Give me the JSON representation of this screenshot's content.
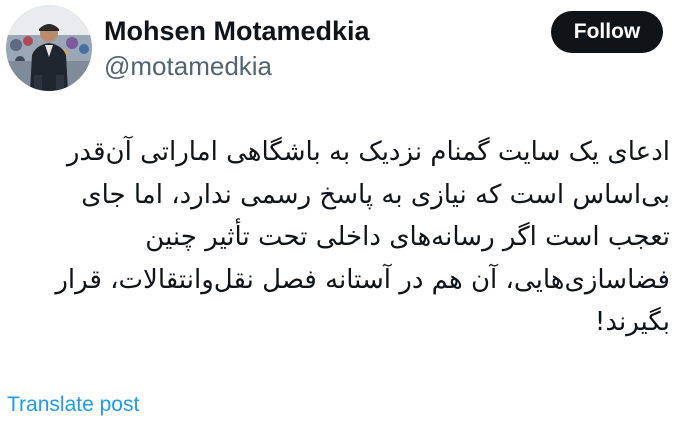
{
  "author": {
    "display_name": "Mohsen Motamedkia",
    "handle": "@motamedkia"
  },
  "actions": {
    "follow_label": "Follow",
    "translate_label": "Translate post"
  },
  "tweet": {
    "lines": [
      "ادعای یک سایت گمنام نزدیک به باشگاهی اماراتی آن‌قدر",
      "بی‌اساس است که نیازی به پاسخ رسمی ندارد، اما جای",
      "تعجب است اگر رسانه‌های داخلی تحت تأثیر چنین",
      "فضاسازی‌هایی، آن هم در آستانه فصل نقل‌وانتقالات، قرار",
      "بگیرند!"
    ]
  },
  "colors": {
    "text_primary": "#0f1419",
    "text_secondary": "#536471",
    "link": "#1d9bf0",
    "button_bg": "#0f1419"
  }
}
